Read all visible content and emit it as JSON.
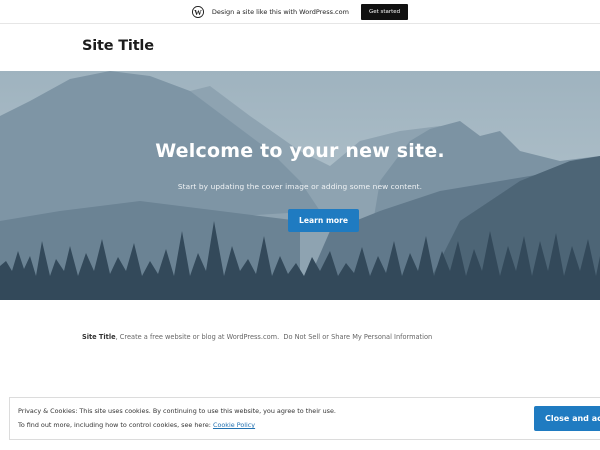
{
  "wpbar": {
    "logo_icon": "wordpress-logo-icon",
    "text": "Design a site like this with WordPress.com",
    "cta_label": "Get started"
  },
  "header": {
    "site_title": "Site Title"
  },
  "cover": {
    "heading": "Welcome to your new site.",
    "subtext": "Start by updating the cover image or adding some new content.",
    "button_label": "Learn more"
  },
  "footer": {
    "site_title": "Site Title",
    "comma": ",",
    "link_text": "Create a free website or blog at WordPress.com",
    "period": ".",
    "privacy_link": "Do Not Sell or Share My Personal Information"
  },
  "cookie_banner": {
    "line1": "Privacy & Cookies: This site uses cookies. By continuing to use this website, you agree to their use.",
    "line2_prefix": "To find out more, including how to control cookies, see here:",
    "policy_link": "Cookie Policy",
    "button_label": "Close and accept"
  },
  "colors": {
    "accent": "#1f7bc1",
    "link": "#2271b1",
    "top_button": "#111111"
  }
}
